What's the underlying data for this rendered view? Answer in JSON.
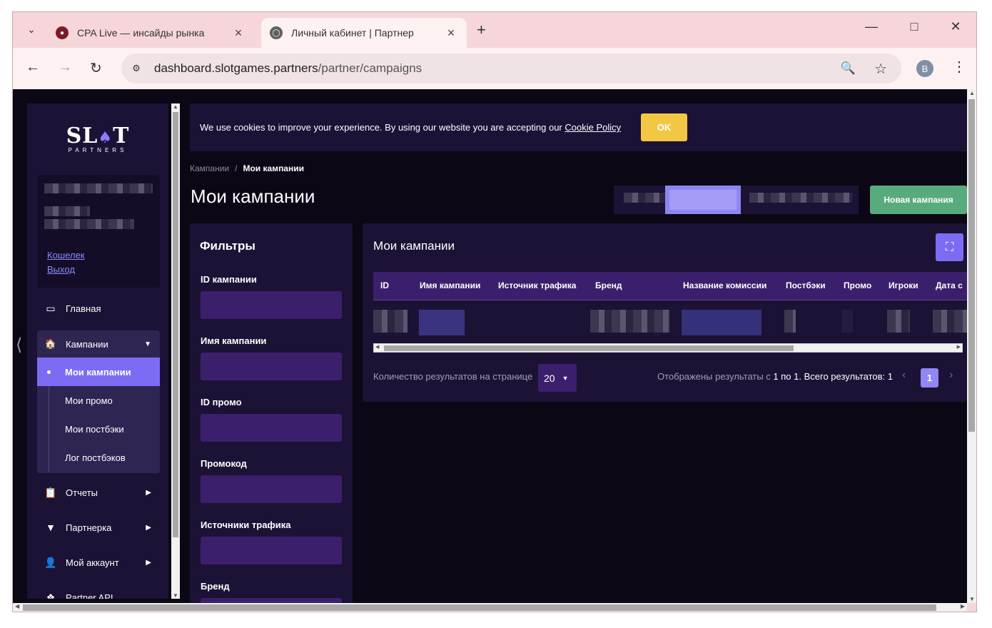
{
  "browser": {
    "tabs": [
      {
        "title": "CPA Live — инсайды рынка",
        "favicon": "cpa-favicon"
      },
      {
        "title": "Личный кабинет | Партнер",
        "favicon": "globe-icon"
      }
    ],
    "url_host": "dashboard.slotgames.partners",
    "url_path": "/partner/campaigns",
    "profile_initial": "B"
  },
  "logo": {
    "main_left": "SL",
    "main_right": "T",
    "sub": "PARTNERS"
  },
  "user_card": {
    "wallet_link": "Кошелек",
    "logout_link": "Выход"
  },
  "sidebar": {
    "home": "Главная",
    "campaigns": "Кампании",
    "campaigns_sub": [
      "Мои кампании",
      "Мои промо",
      "Мои постбэки",
      "Лог постбэков"
    ],
    "reports": "Отчеты",
    "partner": "Партнерка",
    "account": "Мой аккаунт",
    "api": "Partner API"
  },
  "cookie": {
    "text": "We use cookies to improve your experience. By using our website you are accepting our ",
    "link": "Cookie Policy",
    "ok": "OK"
  },
  "breadcrumb": {
    "root": "Кампании",
    "sep": "/",
    "current": "Мои кампании"
  },
  "page_title": "Мои кампании",
  "new_campaign_button": "Новая кампания",
  "filters": {
    "title": "Фильтры",
    "labels": [
      "ID кампании",
      "Имя кампании",
      "ID промо",
      "Промокод",
      "Источники трафика",
      "Бренд"
    ]
  },
  "table": {
    "title": "Мои кампании",
    "columns": [
      "ID",
      "Имя кампании",
      "Источник трафика",
      "Бренд",
      "Название комиссии",
      "Постбэки",
      "Промо",
      "Игроки",
      "Дата с"
    ]
  },
  "pagination": {
    "per_page_label": "Количество результатов на странице",
    "per_page_value": "20",
    "results_prefix": "Отображены результаты с ",
    "from": "1",
    "mid": " по ",
    "to": "1",
    "total_label": ". Всего результатов: ",
    "total": "1",
    "current_page": "1"
  },
  "colors": {
    "background": "#0c0715",
    "panel": "#1c1236",
    "input": "#3b1f6c",
    "accent": "#7c6cf3",
    "ok_button": "#f2c744",
    "new_button": "#58ab7c"
  }
}
